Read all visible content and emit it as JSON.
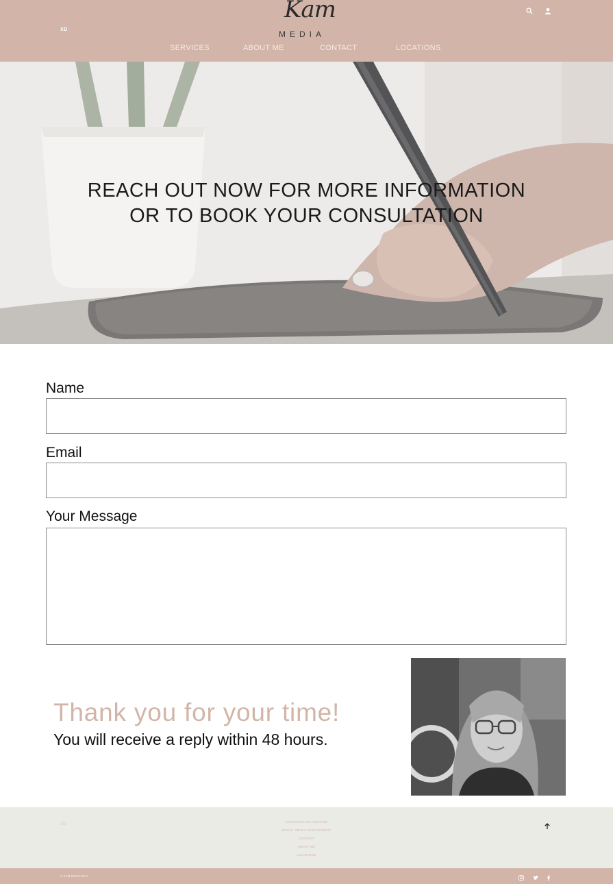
{
  "header": {
    "badge": "XD",
    "logo_script": "Kam",
    "logo_word": "MEDIA",
    "nav": [
      "SERVICES",
      "ABOUT ME",
      "CONTACT",
      "LOCATIONS"
    ],
    "icons": [
      "search-icon",
      "user-icon"
    ]
  },
  "hero": {
    "line1": "REACH OUT NOW FOR MORE INFORMATION",
    "line2": "OR TO BOOK YOUR CONSULTATION"
  },
  "form": {
    "name_label": "Name",
    "name_value": "",
    "email_label": "Email",
    "email_value": "",
    "message_label": "Your Message",
    "message_value": ""
  },
  "thanks": {
    "title": "Thank you for your time!",
    "subtitle": "You will receive a reply within 48 hours."
  },
  "footer": {
    "badge": "XD",
    "links": [
      "PHOTOGRAPHY SESSION",
      "SOCIAL MEDIA MANAGEMENT",
      "CONTACT",
      "ABOUT ME",
      "LOCATIONS"
    ],
    "copyright": "© KAM MEDIA 2017",
    "social_icons": [
      "instagram-icon",
      "twitter-icon",
      "facebook-icon"
    ]
  },
  "colors": {
    "brand": "#d2b5a8",
    "footer_bg": "#ebebe5"
  }
}
